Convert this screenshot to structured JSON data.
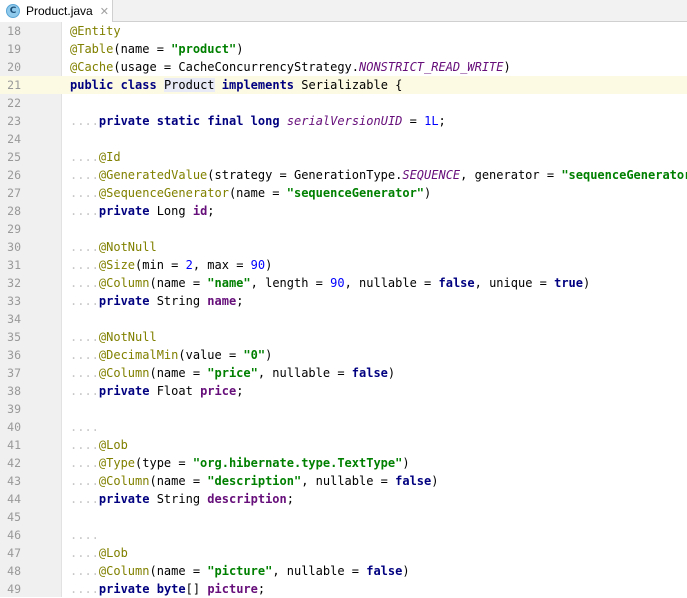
{
  "tab": {
    "filename": "Product.java",
    "icon": "java-class-icon",
    "icon_letter": "C",
    "close_glyph": "✕"
  },
  "editor": {
    "current_line": 21,
    "lines": [
      {
        "n": "18",
        "t": [
          [
            "ann",
            "@Entity"
          ]
        ]
      },
      {
        "n": "19",
        "t": [
          [
            "ann",
            "@Table"
          ],
          [
            "p",
            "(name = "
          ],
          [
            "str",
            "\"product\""
          ],
          [
            "p",
            ")"
          ]
        ]
      },
      {
        "n": "20",
        "t": [
          [
            "ann",
            "@Cache"
          ],
          [
            "p",
            "(usage = CacheConcurrencyStrategy."
          ],
          [
            "stf",
            "NONSTRICT_READ_WRITE"
          ],
          [
            "p",
            ")"
          ]
        ]
      },
      {
        "n": "21",
        "t": [
          [
            "kw",
            "public"
          ],
          [
            "p",
            " "
          ],
          [
            "kw",
            "class"
          ],
          [
            "p",
            " "
          ],
          [
            "hl",
            "Product"
          ],
          [
            "p",
            " "
          ],
          [
            "kw",
            "implements"
          ],
          [
            "p",
            " Serializable {"
          ]
        ]
      },
      {
        "n": "22",
        "t": []
      },
      {
        "n": "23",
        "t": [
          [
            "ws",
            "...."
          ],
          [
            "kw",
            "private"
          ],
          [
            "p",
            " "
          ],
          [
            "kw",
            "static"
          ],
          [
            "p",
            " "
          ],
          [
            "kw",
            "final"
          ],
          [
            "p",
            " "
          ],
          [
            "kw",
            "long"
          ],
          [
            "p",
            " "
          ],
          [
            "stf",
            "serialVersionUID"
          ],
          [
            "p",
            " = "
          ],
          [
            "num",
            "1L"
          ],
          [
            "p",
            ";"
          ]
        ]
      },
      {
        "n": "24",
        "t": []
      },
      {
        "n": "25",
        "t": [
          [
            "ws",
            "...."
          ],
          [
            "ann",
            "@Id"
          ]
        ]
      },
      {
        "n": "26",
        "t": [
          [
            "ws",
            "...."
          ],
          [
            "ann",
            "@GeneratedValue"
          ],
          [
            "p",
            "(strategy = GenerationType."
          ],
          [
            "stf",
            "SEQUENCE"
          ],
          [
            "p",
            ", generator = "
          ],
          [
            "str",
            "\"sequenceGenerator\""
          ],
          [
            "p",
            ")"
          ]
        ]
      },
      {
        "n": "27",
        "t": [
          [
            "ws",
            "...."
          ],
          [
            "ann",
            "@SequenceGenerator"
          ],
          [
            "p",
            "(name = "
          ],
          [
            "str",
            "\"sequenceGenerator\""
          ],
          [
            "p",
            ")"
          ]
        ]
      },
      {
        "n": "28",
        "t": [
          [
            "ws",
            "...."
          ],
          [
            "kw",
            "private"
          ],
          [
            "p",
            " Long "
          ],
          [
            "fld",
            "id"
          ],
          [
            "p",
            ";"
          ]
        ]
      },
      {
        "n": "29",
        "t": []
      },
      {
        "n": "30",
        "t": [
          [
            "ws",
            "...."
          ],
          [
            "ann",
            "@NotNull"
          ]
        ]
      },
      {
        "n": "31",
        "t": [
          [
            "ws",
            "...."
          ],
          [
            "ann",
            "@Size"
          ],
          [
            "p",
            "(min = "
          ],
          [
            "num",
            "2"
          ],
          [
            "p",
            ", max = "
          ],
          [
            "num",
            "90"
          ],
          [
            "p",
            ")"
          ]
        ]
      },
      {
        "n": "32",
        "t": [
          [
            "ws",
            "...."
          ],
          [
            "ann",
            "@Column"
          ],
          [
            "p",
            "(name = "
          ],
          [
            "str",
            "\"name\""
          ],
          [
            "p",
            ", length = "
          ],
          [
            "num",
            "90"
          ],
          [
            "p",
            ", nullable = "
          ],
          [
            "kw",
            "false"
          ],
          [
            "p",
            ", unique = "
          ],
          [
            "kw",
            "true"
          ],
          [
            "p",
            ")"
          ]
        ]
      },
      {
        "n": "33",
        "t": [
          [
            "ws",
            "...."
          ],
          [
            "kw",
            "private"
          ],
          [
            "p",
            " String "
          ],
          [
            "fld",
            "name"
          ],
          [
            "p",
            ";"
          ]
        ]
      },
      {
        "n": "34",
        "t": []
      },
      {
        "n": "35",
        "t": [
          [
            "ws",
            "...."
          ],
          [
            "ann",
            "@NotNull"
          ]
        ]
      },
      {
        "n": "36",
        "t": [
          [
            "ws",
            "...."
          ],
          [
            "ann",
            "@DecimalMin"
          ],
          [
            "p",
            "(value = "
          ],
          [
            "str",
            "\"0\""
          ],
          [
            "p",
            ")"
          ]
        ]
      },
      {
        "n": "37",
        "t": [
          [
            "ws",
            "...."
          ],
          [
            "ann",
            "@Column"
          ],
          [
            "p",
            "(name = "
          ],
          [
            "str",
            "\"price\""
          ],
          [
            "p",
            ", nullable = "
          ],
          [
            "kw",
            "false"
          ],
          [
            "p",
            ")"
          ]
        ]
      },
      {
        "n": "38",
        "t": [
          [
            "ws",
            "...."
          ],
          [
            "kw",
            "private"
          ],
          [
            "p",
            " Float "
          ],
          [
            "fld",
            "price"
          ],
          [
            "p",
            ";"
          ]
        ]
      },
      {
        "n": "39",
        "t": []
      },
      {
        "n": "40",
        "t": [
          [
            "ws",
            "...."
          ]
        ]
      },
      {
        "n": "41",
        "t": [
          [
            "ws",
            "...."
          ],
          [
            "ann",
            "@Lob"
          ]
        ]
      },
      {
        "n": "42",
        "t": [
          [
            "ws",
            "...."
          ],
          [
            "ann",
            "@Type"
          ],
          [
            "p",
            "(type = "
          ],
          [
            "str",
            "\"org.hibernate.type.TextType\""
          ],
          [
            "p",
            ")"
          ]
        ]
      },
      {
        "n": "43",
        "t": [
          [
            "ws",
            "...."
          ],
          [
            "ann",
            "@Column"
          ],
          [
            "p",
            "(name = "
          ],
          [
            "str",
            "\"description\""
          ],
          [
            "p",
            ", nullable = "
          ],
          [
            "kw",
            "false"
          ],
          [
            "p",
            ")"
          ]
        ]
      },
      {
        "n": "44",
        "t": [
          [
            "ws",
            "...."
          ],
          [
            "kw",
            "private"
          ],
          [
            "p",
            " String "
          ],
          [
            "fld",
            "description"
          ],
          [
            "p",
            ";"
          ]
        ]
      },
      {
        "n": "45",
        "t": []
      },
      {
        "n": "46",
        "t": [
          [
            "ws",
            "...."
          ]
        ]
      },
      {
        "n": "47",
        "t": [
          [
            "ws",
            "...."
          ],
          [
            "ann",
            "@Lob"
          ]
        ]
      },
      {
        "n": "48",
        "t": [
          [
            "ws",
            "...."
          ],
          [
            "ann",
            "@Column"
          ],
          [
            "p",
            "(name = "
          ],
          [
            "str",
            "\"picture\""
          ],
          [
            "p",
            ", nullable = "
          ],
          [
            "kw",
            "false"
          ],
          [
            "p",
            ")"
          ]
        ]
      },
      {
        "n": "49",
        "t": [
          [
            "ws",
            "...."
          ],
          [
            "kw",
            "private"
          ],
          [
            "p",
            " "
          ],
          [
            "kw",
            "byte"
          ],
          [
            "p",
            "[] "
          ],
          [
            "fld",
            "picture"
          ],
          [
            "p",
            ";"
          ]
        ]
      }
    ]
  }
}
